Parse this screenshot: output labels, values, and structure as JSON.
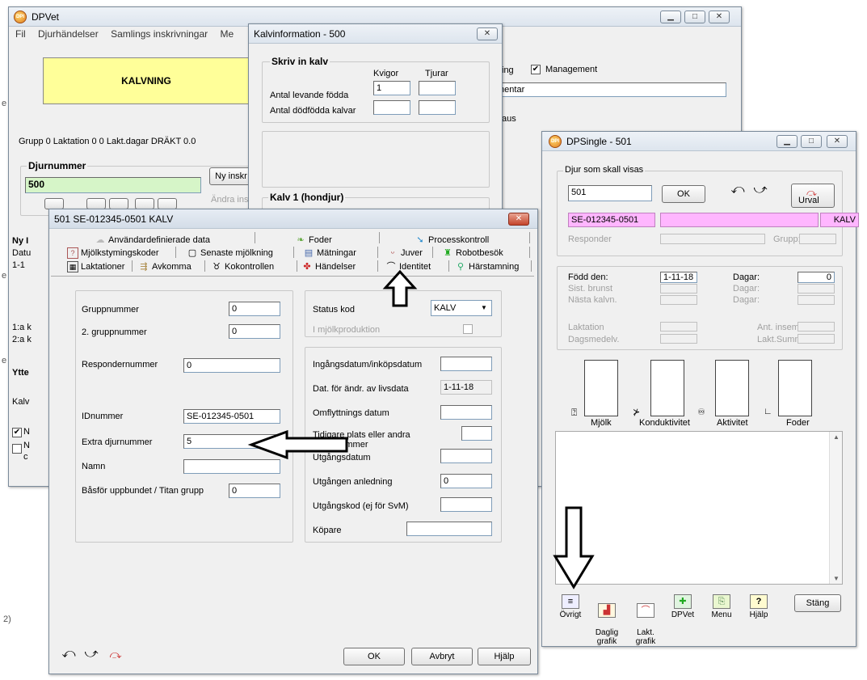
{
  "edge": {
    "marks": [
      "e",
      "e",
      "e"
    ],
    "bottom_mark": "2)"
  },
  "dpvet": {
    "title": "DPVet",
    "menu": [
      "Fil",
      "Djurhändelser",
      "Samlings inskrivningar",
      "Me"
    ],
    "banner": "KALVNING",
    "right_top": {
      "frag1": "ing",
      "management_label": "Management",
      "management_checked": "✔",
      "field_text": "mentar",
      "aus": "aus"
    },
    "status_line": "Grupp 0   Laktation 0     0 Lakt.dagar DRÄKT  0.0",
    "djurnummer": {
      "title": "Djurnummer",
      "value": "500",
      "new_btn": "Ny inskr",
      "change_btn": "Ändra ins"
    },
    "side_labels": [
      "Ny I",
      "Datu",
      "1-1",
      "1:a k",
      "2:a k",
      "Ytte",
      "Kalv",
      "N",
      "N",
      "c"
    ]
  },
  "kalvinfo": {
    "title": "Kalvinformation - 500",
    "group_title": "Skriv in kalv",
    "col_kvigor": "Kvigor",
    "col_tjurar": "Tjurar",
    "row1": "Antal levande födda",
    "row1_value": "1",
    "row2": "Antal dödfödda kalvar",
    "kalv1": "Kalv 1 (hondjur)"
  },
  "dpsingle": {
    "title": "DPSingle - 501",
    "group1_title": "Djur som skall visas",
    "animal_input": "501",
    "ok": "OK",
    "urval": "Urval",
    "id_number": "SE-012345-0501",
    "status": "KALV",
    "responder": "Responder",
    "grupp": "Grupp:",
    "fodd_label": "Född den:",
    "fodd_value": "1-11-18",
    "dagar1_label": "Dagar:",
    "dagar1_value": "0",
    "sist_brunst": "Sist. brunst",
    "dagar2": "Dagar:",
    "nasta_kalvn": "Nästa kalvn.",
    "dagar3": "Dagar:",
    "laktation": "Laktation",
    "ant_insem": "Ant. insem.",
    "dagsmedelv": "Dagsmedelv.",
    "lakt_summa": "Lakt.Summa",
    "graphs": [
      "Mjölk",
      "Konduktivitet",
      "Aktivitet",
      "Foder"
    ],
    "toolbar": [
      {
        "label": "Övrigt",
        "icon": "≡"
      },
      {
        "label": "Daglig\ngrafik",
        "icon": "▟"
      },
      {
        "label": "Lakt.\ngrafik",
        "icon": "⌒"
      },
      {
        "label": "DPVet",
        "icon": "✚"
      },
      {
        "label": "Menu",
        "icon": "⎘"
      },
      {
        "label": "Hjälp",
        "icon": "?"
      }
    ],
    "close": "Stäng"
  },
  "animal": {
    "title": "501  SE-012345-0501  KALV",
    "tabs_row1": [
      "Användardefinierade data",
      "Foder",
      "Processkontroll"
    ],
    "tabs_row2": [
      "Mjölkstymingskoder",
      "Senaste mjölkning",
      "Mätningar",
      "Juver",
      "Robotbesök"
    ],
    "tabs_row3": [
      "Laktationer",
      "Avkomma",
      "Kokontrollen",
      "Händelser",
      "Identitet",
      "Härstamning"
    ],
    "left": {
      "gruppnummer": "Gruppnummer",
      "gruppnummer_value": "0",
      "gruppnummer2": "2. gruppnummer",
      "gruppnummer2_value": "0",
      "respondernummer": "Respondernummer",
      "respondernummer_value": "0",
      "idnummer": "IDnummer",
      "idnummer_value": "SE-012345-0501",
      "extra": "Extra djurnummer",
      "extra_value": "5",
      "namn": "Namn",
      "basfor": "Båsför uppbundet / Titan grupp",
      "basfor_value": "0"
    },
    "right": {
      "status_kod": "Status kod",
      "status_value": "KALV",
      "mjolkproduktion": "I mjölkproduktion",
      "ingangsdatum": "Ingångsdatum/inköpsdatum",
      "dat_andr": "Dat. för ändr. av livsdata",
      "dat_andr_value": "1-11-18",
      "omflyttning": "Omflyttnings datum",
      "tidigare_1": "Tidigare plats eller andra",
      "tidigare_2": "gruppnummer",
      "utgangsdatum": "Utgångsdatum",
      "utgangen": "Utgången anledning",
      "utgangen_value": "0",
      "utgangskod": "Utgångskod (ej för SvM)",
      "kopare": "Köpare"
    },
    "buttons": {
      "ok": "OK",
      "cancel": "Avbryt",
      "help": "Hjälp"
    }
  }
}
